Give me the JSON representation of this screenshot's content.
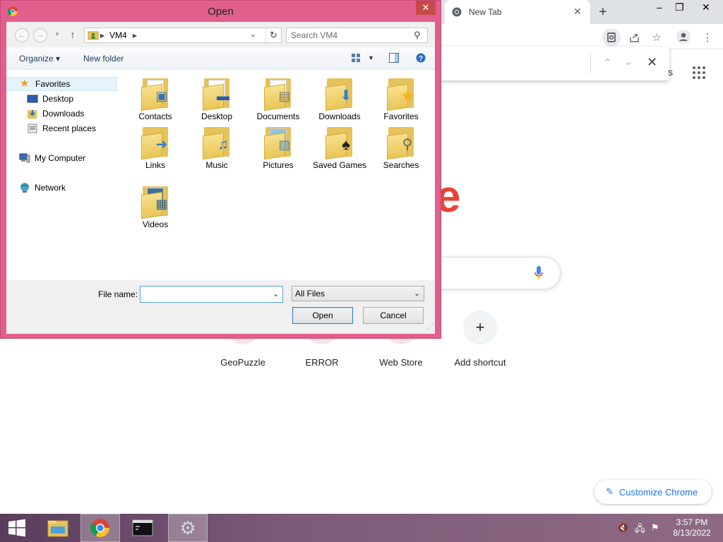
{
  "chrome": {
    "tab_title": "New Tab",
    "apps_partial": "s",
    "logo_fragment": "e",
    "shortcuts": [
      {
        "label": "GeoPuzzle"
      },
      {
        "label": "ERROR"
      },
      {
        "label": "Web Store"
      },
      {
        "label": "Add shortcut"
      }
    ],
    "customize_label": "Customize Chrome"
  },
  "dialog": {
    "title": "Open",
    "address": {
      "crumbs": [
        "VM4"
      ]
    },
    "search_placeholder": "Search VM4",
    "toolbar": {
      "organize": "Organize",
      "new_folder": "New folder"
    },
    "nav": {
      "favorites": "Favorites",
      "desktop": "Desktop",
      "downloads": "Downloads",
      "recent": "Recent places",
      "computer": "My Computer",
      "network": "Network"
    },
    "items": [
      {
        "label": "Contacts",
        "icon": "contacts-folder-icon"
      },
      {
        "label": "Desktop",
        "icon": "desktop-folder-icon"
      },
      {
        "label": "Documents",
        "icon": "documents-folder-icon"
      },
      {
        "label": "Downloads",
        "icon": "downloads-folder-icon"
      },
      {
        "label": "Favorites",
        "icon": "favorites-folder-icon"
      },
      {
        "label": "Links",
        "icon": "links-folder-icon"
      },
      {
        "label": "Music",
        "icon": "music-folder-icon"
      },
      {
        "label": "Pictures",
        "icon": "pictures-folder-icon"
      },
      {
        "label": "Saved Games",
        "icon": "saved-games-folder-icon"
      },
      {
        "label": "Searches",
        "icon": "searches-folder-icon"
      },
      {
        "label": "Videos",
        "icon": "videos-folder-icon"
      }
    ],
    "filename_label": "File name:",
    "filename_value": "",
    "filter_value": "All Files",
    "open_button": "Open",
    "cancel_button": "Cancel"
  },
  "taskbar": {
    "time": "3:57 PM",
    "date": "8/13/2022"
  },
  "colors": {
    "dialog_frame": "#e15f8d",
    "taskbar": "#6d4b6b",
    "chrome_accent": "#1a73e8"
  }
}
